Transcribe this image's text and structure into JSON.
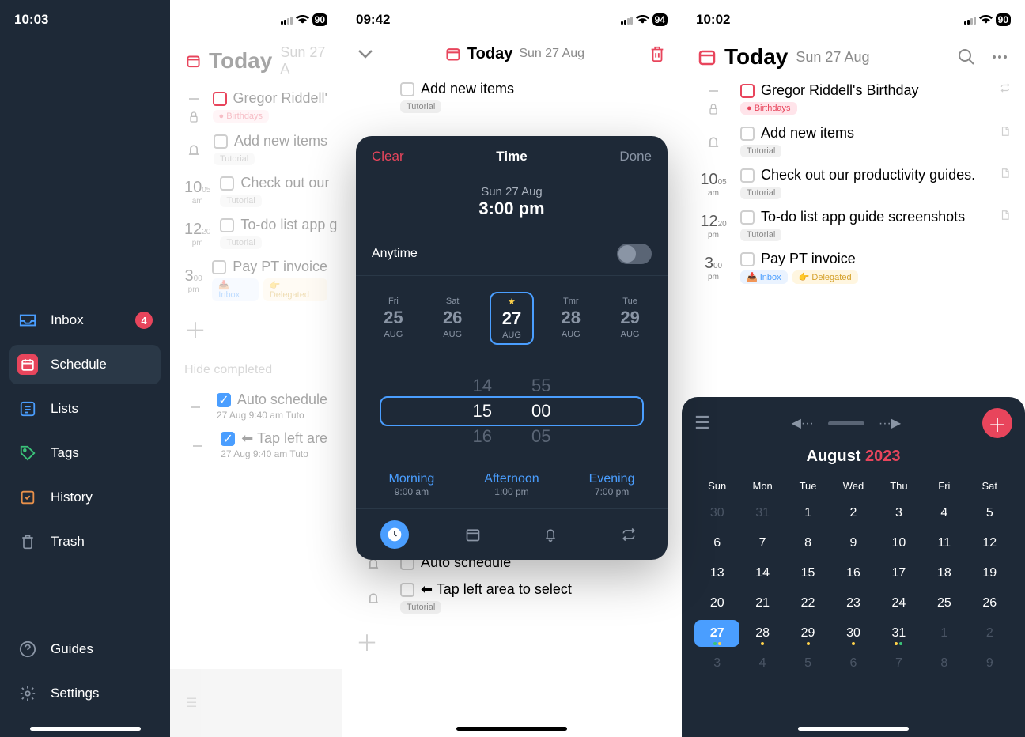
{
  "status": {
    "p1_time": "10:03",
    "p2_time": "09:42",
    "p3_time": "10:02",
    "battery1": "90",
    "battery2": "94",
    "battery3": "90"
  },
  "sidebar": {
    "items": [
      {
        "label": "Inbox",
        "badge": "4"
      },
      {
        "label": "Schedule"
      },
      {
        "label": "Lists"
      },
      {
        "label": "Tags"
      },
      {
        "label": "History"
      },
      {
        "label": "Trash"
      },
      {
        "label": "Guides"
      },
      {
        "label": "Settings"
      }
    ]
  },
  "today": {
    "title": "Today",
    "date": "Sun 27 Aug"
  },
  "p1_tasks": [
    {
      "title": "Gregor Riddell'",
      "tag": "Birthdays"
    },
    {
      "title": "Add new items",
      "tag": "Tutorial"
    },
    {
      "time_h": "10",
      "time_m": "05",
      "time_s": "am",
      "title": "Check out our",
      "tag": "Tutorial"
    },
    {
      "time_h": "12",
      "time_m": "20",
      "time_s": "pm",
      "title": "To-do list app g",
      "tag": "Tutorial"
    },
    {
      "time_h": "3",
      "time_m": "00",
      "time_s": "pm",
      "title": "Pay PT invoice",
      "tag1": "Inbox",
      "tag2": "Delegated"
    }
  ],
  "hide_completed": "Hide completed",
  "completed": [
    {
      "title": "Auto schedule",
      "sub": "27 Aug 9:40 am    Tuto"
    },
    {
      "title": "⬅ Tap left are",
      "sub": "27 Aug 9:40 am    Tuto"
    }
  ],
  "p2_tasks": [
    {
      "title": "Add new items",
      "tag": "Tutorial"
    },
    {
      "title": "Auto schedule"
    },
    {
      "title": "⬅ Tap left area to select",
      "tag": "Tutorial"
    }
  ],
  "modal": {
    "clear": "Clear",
    "title": "Time",
    "done": "Done",
    "date_sub": "Sun 27 Aug",
    "date_main": "3:00 pm",
    "anytime": "Anytime",
    "dates": [
      {
        "dow": "Fri",
        "num": "25",
        "mon": "AUG"
      },
      {
        "dow": "Sat",
        "num": "26",
        "mon": "AUG"
      },
      {
        "star": "★",
        "num": "27",
        "mon": "AUG",
        "selected": true
      },
      {
        "dow": "Tmr",
        "num": "28",
        "mon": "AUG"
      },
      {
        "dow": "Tue",
        "num": "29",
        "mon": "AUG"
      }
    ],
    "picker": {
      "prev": [
        "14",
        "55"
      ],
      "sel": [
        "15",
        "00"
      ],
      "next": [
        "16",
        "05"
      ]
    },
    "presets": [
      {
        "label": "Morning",
        "time": "9:00 am"
      },
      {
        "label": "Afternoon",
        "time": "1:00 pm"
      },
      {
        "label": "Evening",
        "time": "7:00 pm"
      }
    ]
  },
  "p3_tasks": [
    {
      "title": "Gregor Riddell's Birthday",
      "tag": "Birthdays",
      "red": true
    },
    {
      "title": "Add new items",
      "tag": "Tutorial"
    },
    {
      "time_h": "10",
      "time_m": "05",
      "time_s": "am",
      "title": "Check out our productivity guides.",
      "tag": "Tutorial"
    },
    {
      "time_h": "12",
      "time_m": "20",
      "time_s": "pm",
      "title": "To-do list app guide screenshots",
      "tag": "Tutorial"
    },
    {
      "time_h": "3",
      "time_m": "00",
      "time_s": "pm",
      "title": "Pay PT invoice",
      "tag1": "Inbox",
      "tag2": "Delegated"
    }
  ],
  "calendar": {
    "month": "August",
    "year": "2023",
    "dow": [
      "Sun",
      "Mon",
      "Tue",
      "Wed",
      "Thu",
      "Fri",
      "Sat"
    ],
    "weeks": [
      [
        {
          "n": "30",
          "m": 1
        },
        {
          "n": "31",
          "m": 1
        },
        {
          "n": "1"
        },
        {
          "n": "2"
        },
        {
          "n": "3"
        },
        {
          "n": "4"
        },
        {
          "n": "5"
        }
      ],
      [
        {
          "n": "6"
        },
        {
          "n": "7"
        },
        {
          "n": "8"
        },
        {
          "n": "9"
        },
        {
          "n": "10"
        },
        {
          "n": "11"
        },
        {
          "n": "12"
        }
      ],
      [
        {
          "n": "13"
        },
        {
          "n": "14"
        },
        {
          "n": "15"
        },
        {
          "n": "16"
        },
        {
          "n": "17"
        },
        {
          "n": "18"
        },
        {
          "n": "19"
        }
      ],
      [
        {
          "n": "20"
        },
        {
          "n": "21"
        },
        {
          "n": "22"
        },
        {
          "n": "23"
        },
        {
          "n": "24"
        },
        {
          "n": "25"
        },
        {
          "n": "26"
        }
      ],
      [
        {
          "n": "27",
          "today": 1,
          "dots": [
            "g",
            "y"
          ]
        },
        {
          "n": "28",
          "dots": [
            "y"
          ]
        },
        {
          "n": "29",
          "dots": [
            "y"
          ]
        },
        {
          "n": "30",
          "dots": [
            "y"
          ]
        },
        {
          "n": "31",
          "dots": [
            "y",
            "g"
          ]
        },
        {
          "n": "1",
          "m": 1
        },
        {
          "n": "2",
          "m": 1
        }
      ],
      [
        {
          "n": "3",
          "m": 1
        },
        {
          "n": "4",
          "m": 1
        },
        {
          "n": "5",
          "m": 1
        },
        {
          "n": "6",
          "m": 1
        },
        {
          "n": "7",
          "m": 1
        },
        {
          "n": "8",
          "m": 1
        },
        {
          "n": "9",
          "m": 1
        }
      ]
    ]
  }
}
